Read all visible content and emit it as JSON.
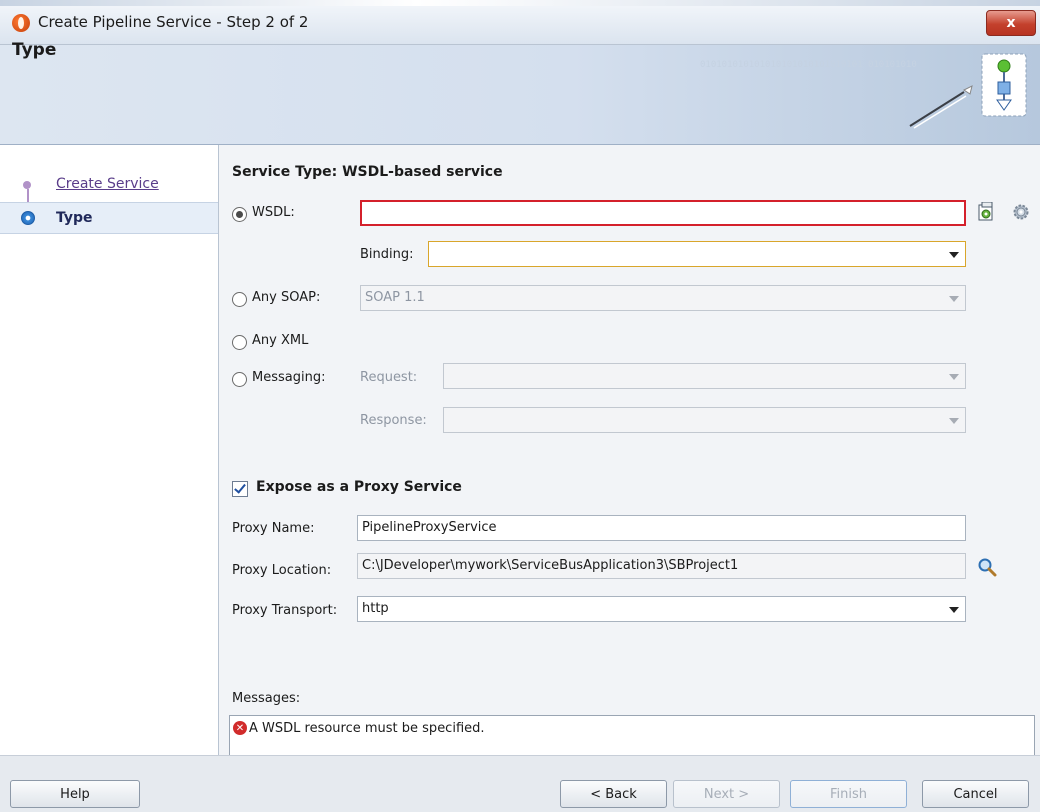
{
  "window": {
    "title": "Create Pipeline Service - Step 2 of 2",
    "close_label": "x"
  },
  "header": {
    "title": "Type",
    "binary_text": "010101010101010101010101010101 010101010"
  },
  "nav": {
    "items": [
      {
        "label": "Create Service",
        "state": "visited"
      },
      {
        "label": "Type",
        "state": "current"
      }
    ]
  },
  "service_type": {
    "heading": "Service Type: WSDL-based service",
    "wsdl": {
      "label": "WSDL:",
      "value": "",
      "selected": true
    },
    "binding": {
      "label": "Binding:",
      "value": ""
    },
    "any_soap": {
      "label": "Any SOAP:",
      "value": "SOAP 1.1"
    },
    "any_xml": {
      "label": "Any XML"
    },
    "messaging": {
      "label": "Messaging:",
      "request_label": "Request:",
      "response_label": "Response:"
    }
  },
  "proxy": {
    "expose_label": "Expose as a Proxy Service",
    "expose_checked": true,
    "name_label": "Proxy Name:",
    "name_value": "PipelineProxyService",
    "location_label": "Proxy Location:",
    "location_value": "C:\\JDeveloper\\mywork\\ServiceBusApplication3\\SBProject1",
    "transport_label": "Proxy Transport:",
    "transport_value": "http"
  },
  "messages": {
    "label": "Messages:",
    "items": [
      "A WSDL resource must be specified."
    ]
  },
  "footer": {
    "help": "Help",
    "back": "< Back",
    "next": "Next >",
    "finish": "Finish",
    "cancel": "Cancel"
  },
  "colors": {
    "error": "#d4202b",
    "accent": "#2a72c2",
    "link": "#5a3d8a"
  },
  "icons": [
    "app-logo-icon",
    "close-icon",
    "wizard-graphic-icon",
    "browse-wsdl-icon",
    "settings-gear-icon",
    "search-icon",
    "error-icon"
  ]
}
